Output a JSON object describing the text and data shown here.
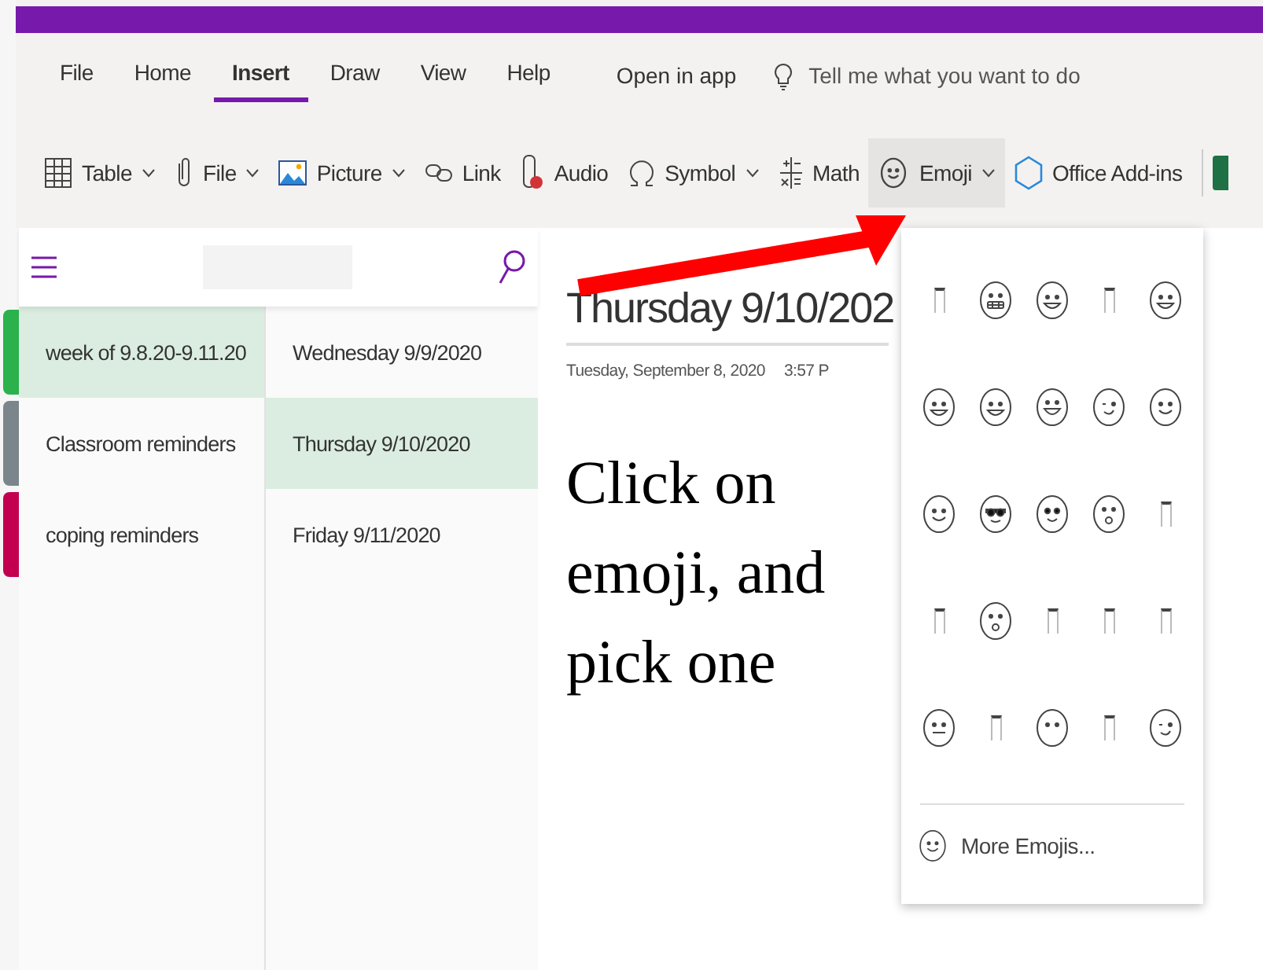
{
  "menu": {
    "tabs": [
      {
        "label": "File",
        "selected": false
      },
      {
        "label": "Home",
        "selected": false
      },
      {
        "label": "Insert",
        "selected": true
      },
      {
        "label": "Draw",
        "selected": false
      },
      {
        "label": "View",
        "selected": false
      },
      {
        "label": "Help",
        "selected": false
      }
    ],
    "open_in_app": "Open in app",
    "tell_me": {
      "placeholder": "Tell me what you want to do"
    }
  },
  "toolbar": [
    {
      "kind": "table",
      "label": "Table",
      "dropdown": true,
      "open": false
    },
    {
      "kind": "file",
      "label": "File",
      "dropdown": true,
      "open": false
    },
    {
      "kind": "picture",
      "label": "Picture",
      "dropdown": true,
      "open": false
    },
    {
      "kind": "link",
      "label": "Link",
      "dropdown": false,
      "open": false
    },
    {
      "kind": "audio",
      "label": "Audio",
      "dropdown": false,
      "open": false
    },
    {
      "kind": "symbol",
      "label": "Symbol",
      "dropdown": true,
      "open": false
    },
    {
      "kind": "math",
      "label": "Math",
      "dropdown": false,
      "open": false
    },
    {
      "kind": "emoji",
      "label": "Emoji",
      "dropdown": true,
      "open": true
    },
    {
      "kind": "addins",
      "label": "Office Add-ins",
      "dropdown": false,
      "open": false
    }
  ],
  "sections": [
    {
      "name": "week of 9.8.20-9.11.20",
      "color": "#2bb24c",
      "selected": true
    },
    {
      "name": "Classroom reminders",
      "color": "#7a868c",
      "selected": false
    },
    {
      "name": "coping reminders",
      "color": "#c3004f",
      "selected": false
    }
  ],
  "pages": [
    {
      "name": "Wednesday 9/9/2020",
      "selected": false
    },
    {
      "name": "Thursday 9/10/2020",
      "selected": true
    },
    {
      "name": "Friday 9/11/2020",
      "selected": false
    }
  ],
  "page": {
    "title": "Thursday 9/10/202",
    "date": "Tuesday, September 8, 2020",
    "time": "3:57 P",
    "body": "Click on emoji, and pick one"
  },
  "emoji_menu": {
    "grid": [
      {
        "kind": "missing"
      },
      {
        "kind": "grimace"
      },
      {
        "kind": "grin"
      },
      {
        "kind": "missing"
      },
      {
        "kind": "grin"
      },
      {
        "kind": "grin"
      },
      {
        "kind": "grin"
      },
      {
        "kind": "tongue"
      },
      {
        "kind": "wink"
      },
      {
        "kind": "smile"
      },
      {
        "kind": "smile"
      },
      {
        "kind": "sunglasses"
      },
      {
        "kind": "heart_eyes"
      },
      {
        "kind": "surprised"
      },
      {
        "kind": "missing"
      },
      {
        "kind": "missing"
      },
      {
        "kind": "surprised"
      },
      {
        "kind": "missing"
      },
      {
        "kind": "missing"
      },
      {
        "kind": "missing"
      },
      {
        "kind": "neutral"
      },
      {
        "kind": "missing"
      },
      {
        "kind": "blank"
      },
      {
        "kind": "missing"
      },
      {
        "kind": "wink"
      }
    ],
    "more": "More Emojis..."
  }
}
